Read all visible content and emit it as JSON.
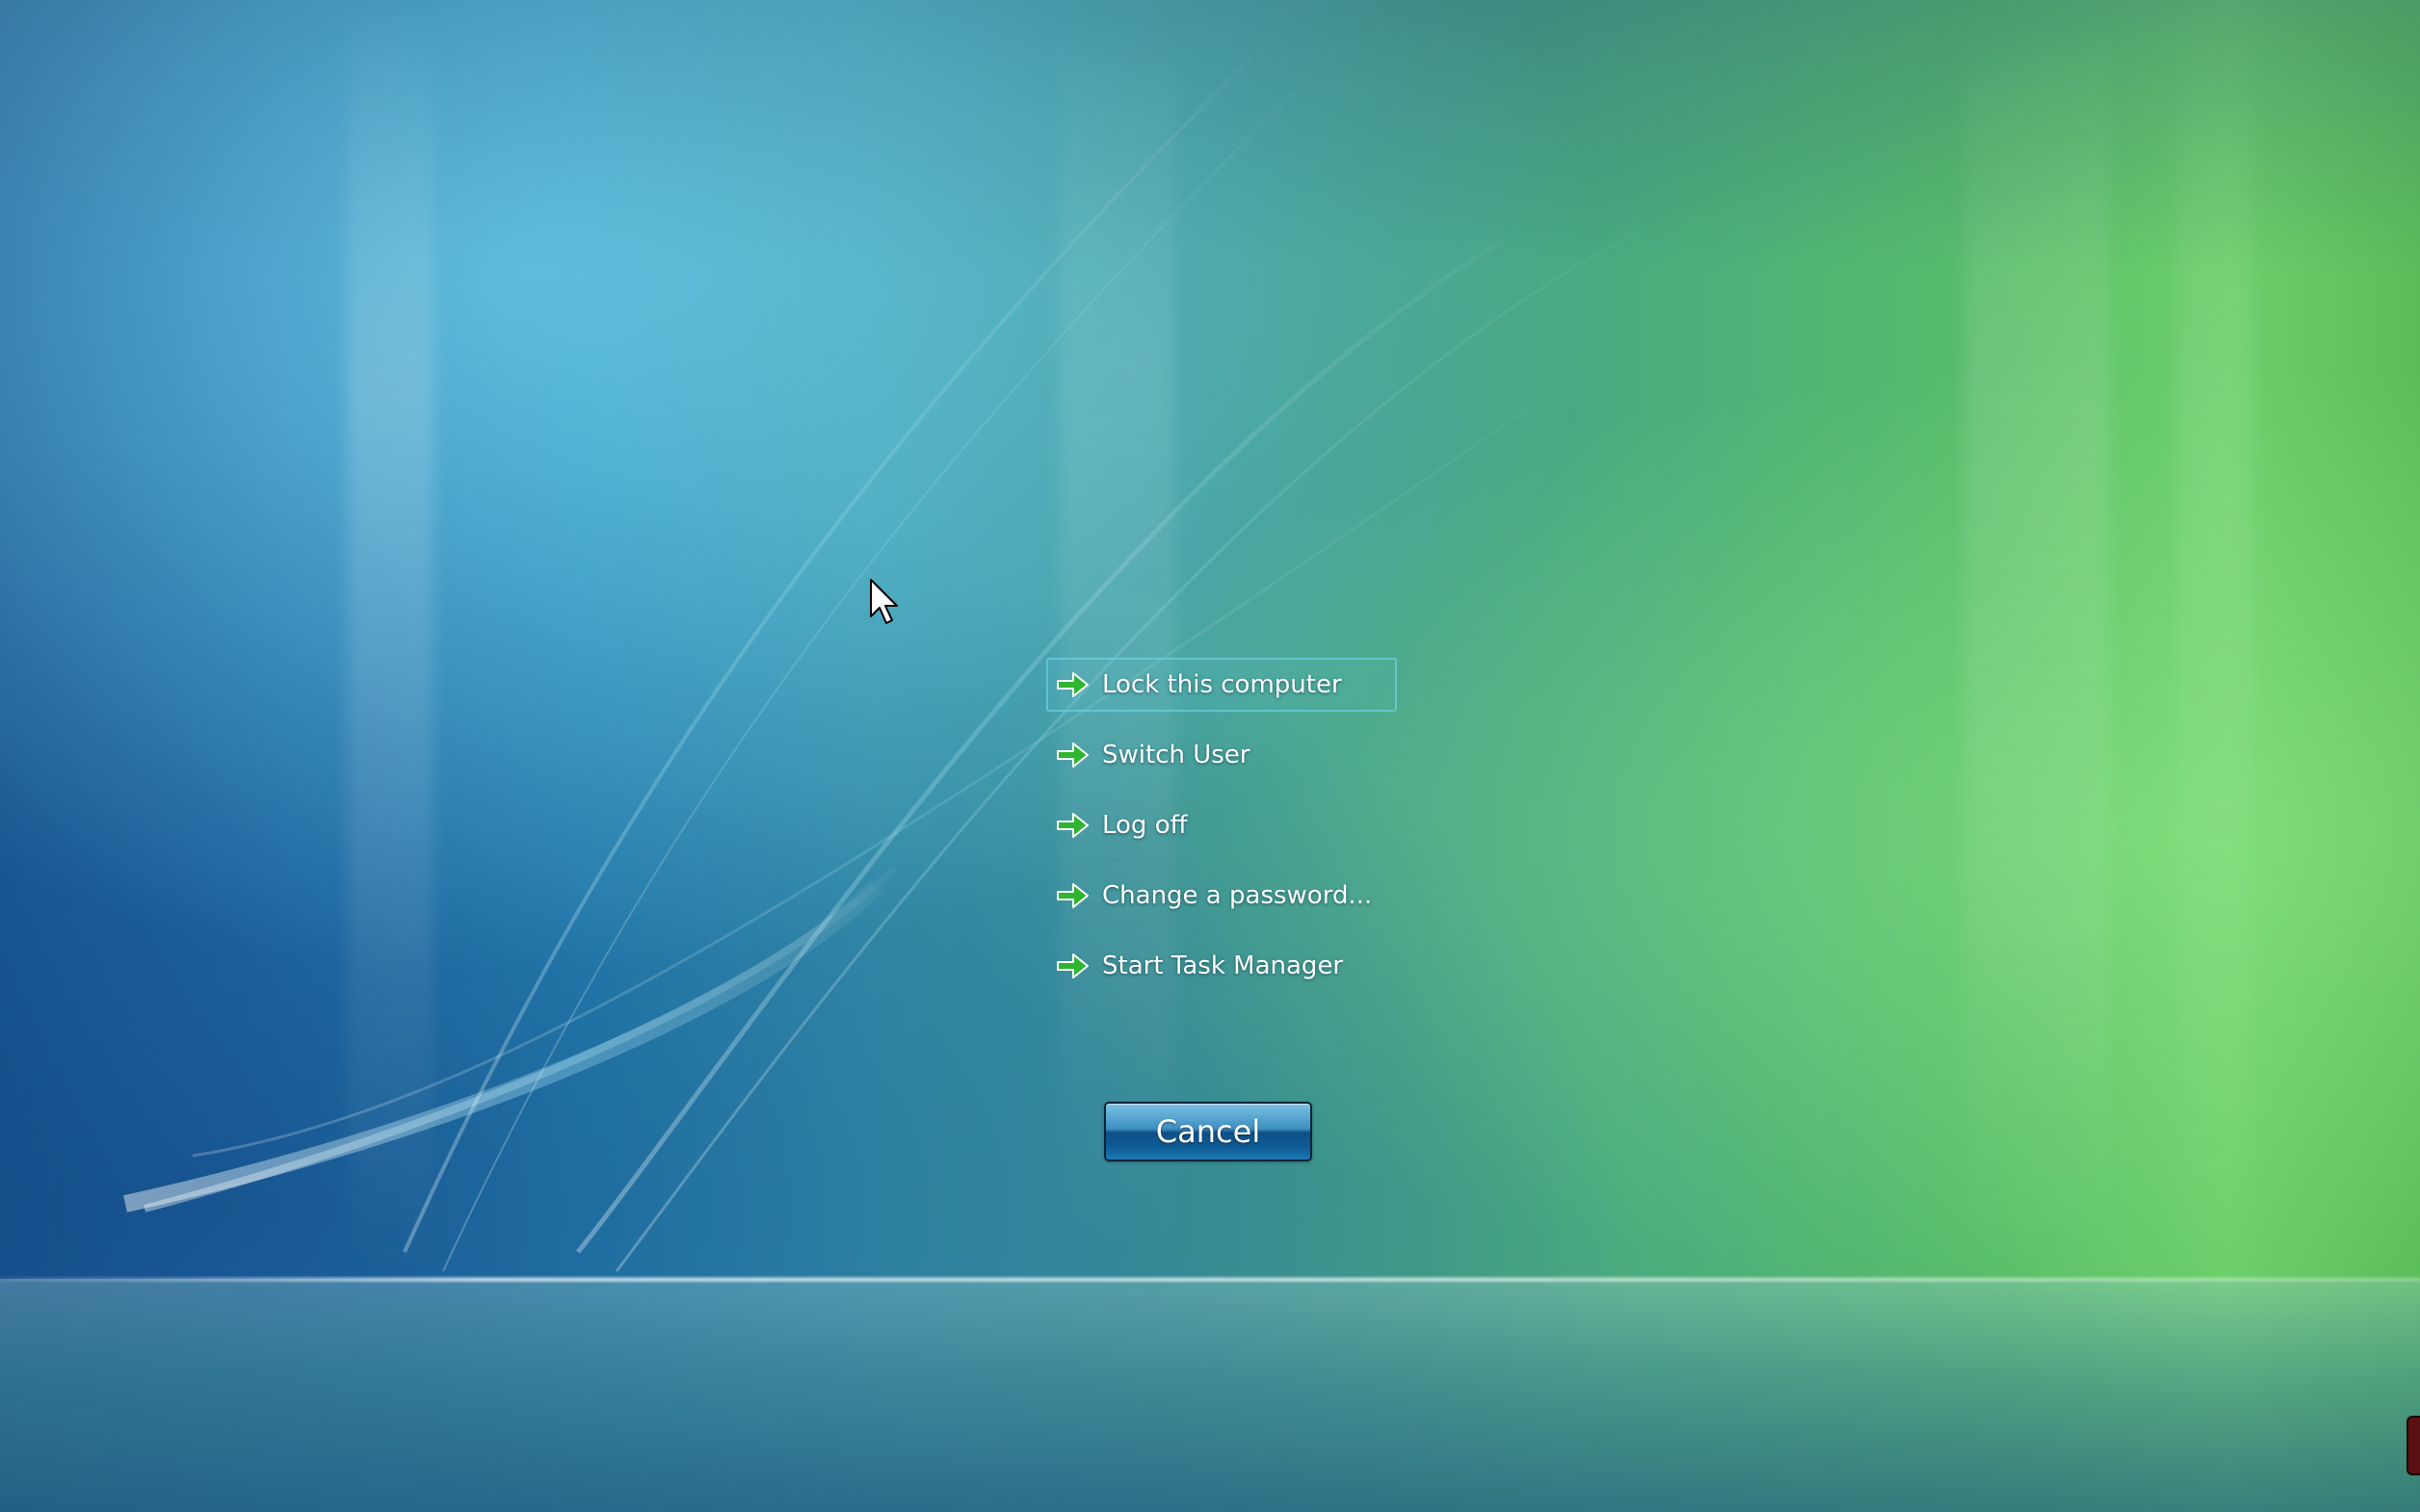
{
  "menu": {
    "items": [
      {
        "label": "Lock this computer",
        "selected": true
      },
      {
        "label": "Switch User",
        "selected": false
      },
      {
        "label": "Log off",
        "selected": false
      },
      {
        "label": "Change a password...",
        "selected": false
      },
      {
        "label": "Start Task Manager",
        "selected": false
      }
    ],
    "item_icon": "green-arrow-icon"
  },
  "cancel_button": {
    "label": "Cancel"
  },
  "colors": {
    "arrow": "#2fb52f",
    "selection_border": "#6ed2e6",
    "button_top": "#7cc2e4",
    "button_bottom": "#0d5b93"
  }
}
